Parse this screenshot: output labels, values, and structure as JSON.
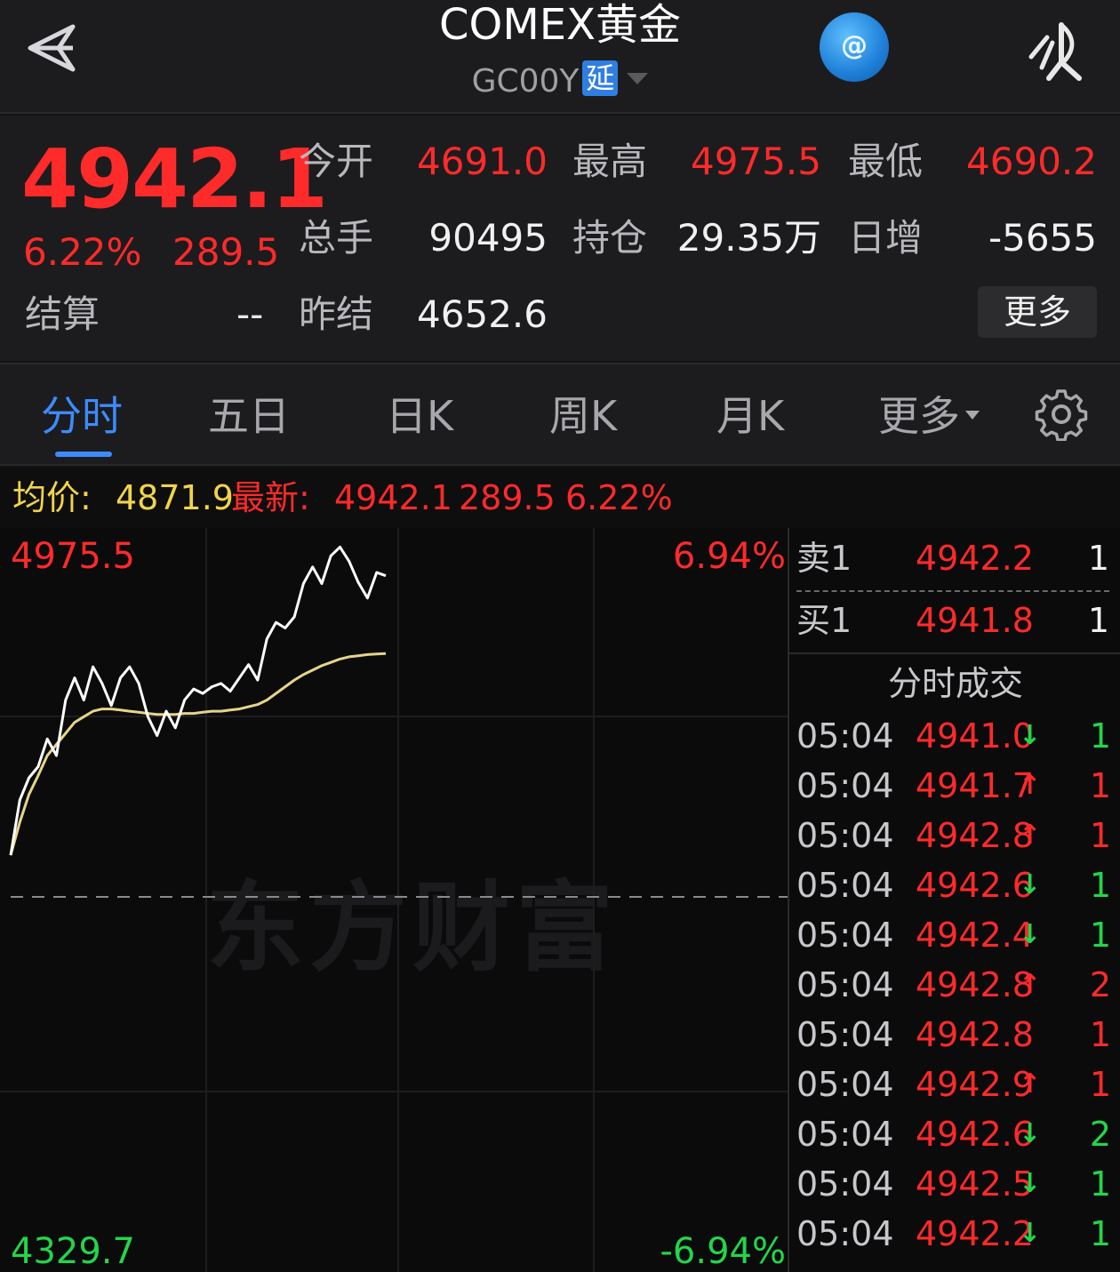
{
  "header": {
    "title": "COMEX黄金",
    "code": "GC00Y",
    "delay_badge": "延"
  },
  "quote": {
    "last": "4942.1",
    "change_pct": "6.22%",
    "change": "289.5",
    "settle_label": "结算",
    "settle_value": "--",
    "open_label": "今开",
    "open_value": "4691.0",
    "high_label": "最高",
    "high_value": "4975.5",
    "low_label": "最低",
    "low_value": "4690.2",
    "volume_label": "总手",
    "volume_value": "90495",
    "oi_label": "持仓",
    "oi_value": "29.35万",
    "daily_inc_label": "日增",
    "daily_inc_value": "-5655",
    "prev_settle_label": "昨结",
    "prev_settle_value": "4652.6",
    "more_label": "更多"
  },
  "tabs": [
    {
      "label": "分时",
      "active": true
    },
    {
      "label": "五日"
    },
    {
      "label": "日K"
    },
    {
      "label": "周K"
    },
    {
      "label": "月K"
    },
    {
      "label": "更多"
    }
  ],
  "infobar": {
    "avg_label": "均价:",
    "avg_value": "4871.9",
    "latest_label": "最新:",
    "latest_value": "4942.1",
    "latest_change": "289.5",
    "latest_pct": "6.22%"
  },
  "chart": {
    "max_label": "4975.5",
    "min_label": "4329.7",
    "max_pct": "6.94%",
    "min_pct": "-6.94%",
    "watermark": "东方财富"
  },
  "chart_data": {
    "type": "line",
    "ylim": [
      4329.7,
      4975.5
    ],
    "baseline": 4652.6,
    "series": [
      {
        "values": [
          4690.2,
          4740,
          4760,
          4770,
          4795,
          4780,
          4830,
          4850,
          4830,
          4860,
          4845,
          4825,
          4850,
          4860,
          4845,
          4815,
          4798,
          4820,
          4805,
          4830,
          4840,
          4836,
          4842,
          4845,
          4838,
          4850,
          4862,
          4848,
          4885,
          4900,
          4895,
          4905,
          4935,
          4950,
          4935,
          4960,
          4968,
          4955,
          4936,
          4922,
          4945,
          4942.1
        ]
      },
      {
        "values": [
          4690.2,
          4720,
          4745,
          4762,
          4780,
          4790,
          4800,
          4810,
          4815,
          4820,
          4822,
          4822,
          4821,
          4820,
          4819,
          4818,
          4817,
          4817,
          4817,
          4818,
          4818,
          4819,
          4820,
          4820,
          4821,
          4822,
          4824,
          4826,
          4830,
          4836,
          4842,
          4848,
          4853,
          4857,
          4861,
          4864,
          4867,
          4869,
          4870,
          4871,
          4871.5,
          4871.9
        ]
      }
    ]
  },
  "book": {
    "ask_label": "卖1",
    "ask_price": "4942.2",
    "ask_vol": "1",
    "bid_label": "买1",
    "bid_price": "4941.8",
    "bid_vol": "1",
    "ticks_title": "分时成交",
    "ticks": [
      {
        "time": "05:04",
        "price": "4941.0",
        "dir": "down",
        "vol": "1"
      },
      {
        "time": "05:04",
        "price": "4941.7",
        "dir": "up",
        "vol": "1"
      },
      {
        "time": "05:04",
        "price": "4942.8",
        "dir": "up",
        "vol": "1"
      },
      {
        "time": "05:04",
        "price": "4942.6",
        "dir": "down",
        "vol": "1"
      },
      {
        "time": "05:04",
        "price": "4942.4",
        "dir": "down",
        "vol": "1"
      },
      {
        "time": "05:04",
        "price": "4942.8",
        "dir": "up",
        "vol": "2"
      },
      {
        "time": "05:04",
        "price": "4942.8",
        "dir": "none",
        "vol": "1"
      },
      {
        "time": "05:04",
        "price": "4942.9",
        "dir": "up",
        "vol": "1"
      },
      {
        "time": "05:04",
        "price": "4942.6",
        "dir": "down",
        "vol": "2"
      },
      {
        "time": "05:04",
        "price": "4942.5",
        "dir": "down",
        "vol": "1"
      },
      {
        "time": "05:04",
        "price": "4942.2",
        "dir": "down",
        "vol": "1"
      }
    ]
  },
  "colors": {
    "up": "#ff2a2a",
    "down": "#22d64a",
    "accent": "#3d8bff",
    "avg_line": "#e6d48a"
  }
}
